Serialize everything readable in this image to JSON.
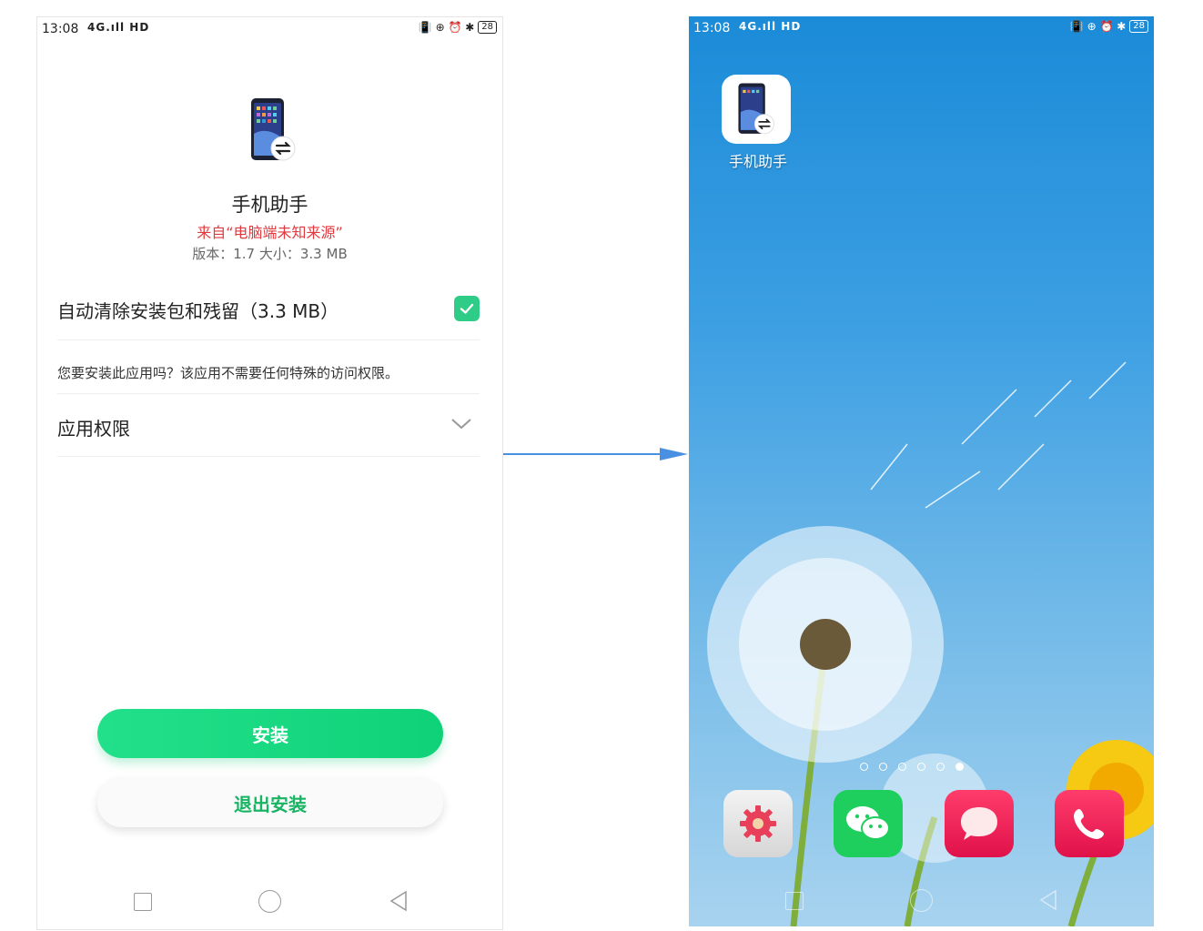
{
  "status_bar": {
    "time": "13:08",
    "network": "4G.ıll HD",
    "battery": "28",
    "indicators": "📳 ⊕ ⏰ ✱"
  },
  "installer": {
    "app_name": "手机助手",
    "source": "来自“电脑端未知来源”",
    "meta": "版本：1.7    大小：3.3 MB",
    "clean_option_label": "自动清除安装包和残留（3.3 MB）",
    "clean_option_checked": true,
    "permission_notice": "您要安装此应用吗？该应用不需要任何特殊的访问权限。",
    "permissions_label": "应用权限",
    "install_button": "安装",
    "exit_button": "退出安装"
  },
  "home": {
    "app_label": "手机助手",
    "page_dots": 6,
    "active_dot": 5,
    "dock": [
      "settings-icon",
      "wechat-icon",
      "messages-icon",
      "phone-icon"
    ]
  },
  "colors": {
    "accent_green": "#22e08a",
    "source_red": "#e0393e",
    "arrow_blue": "#4a90e2"
  }
}
